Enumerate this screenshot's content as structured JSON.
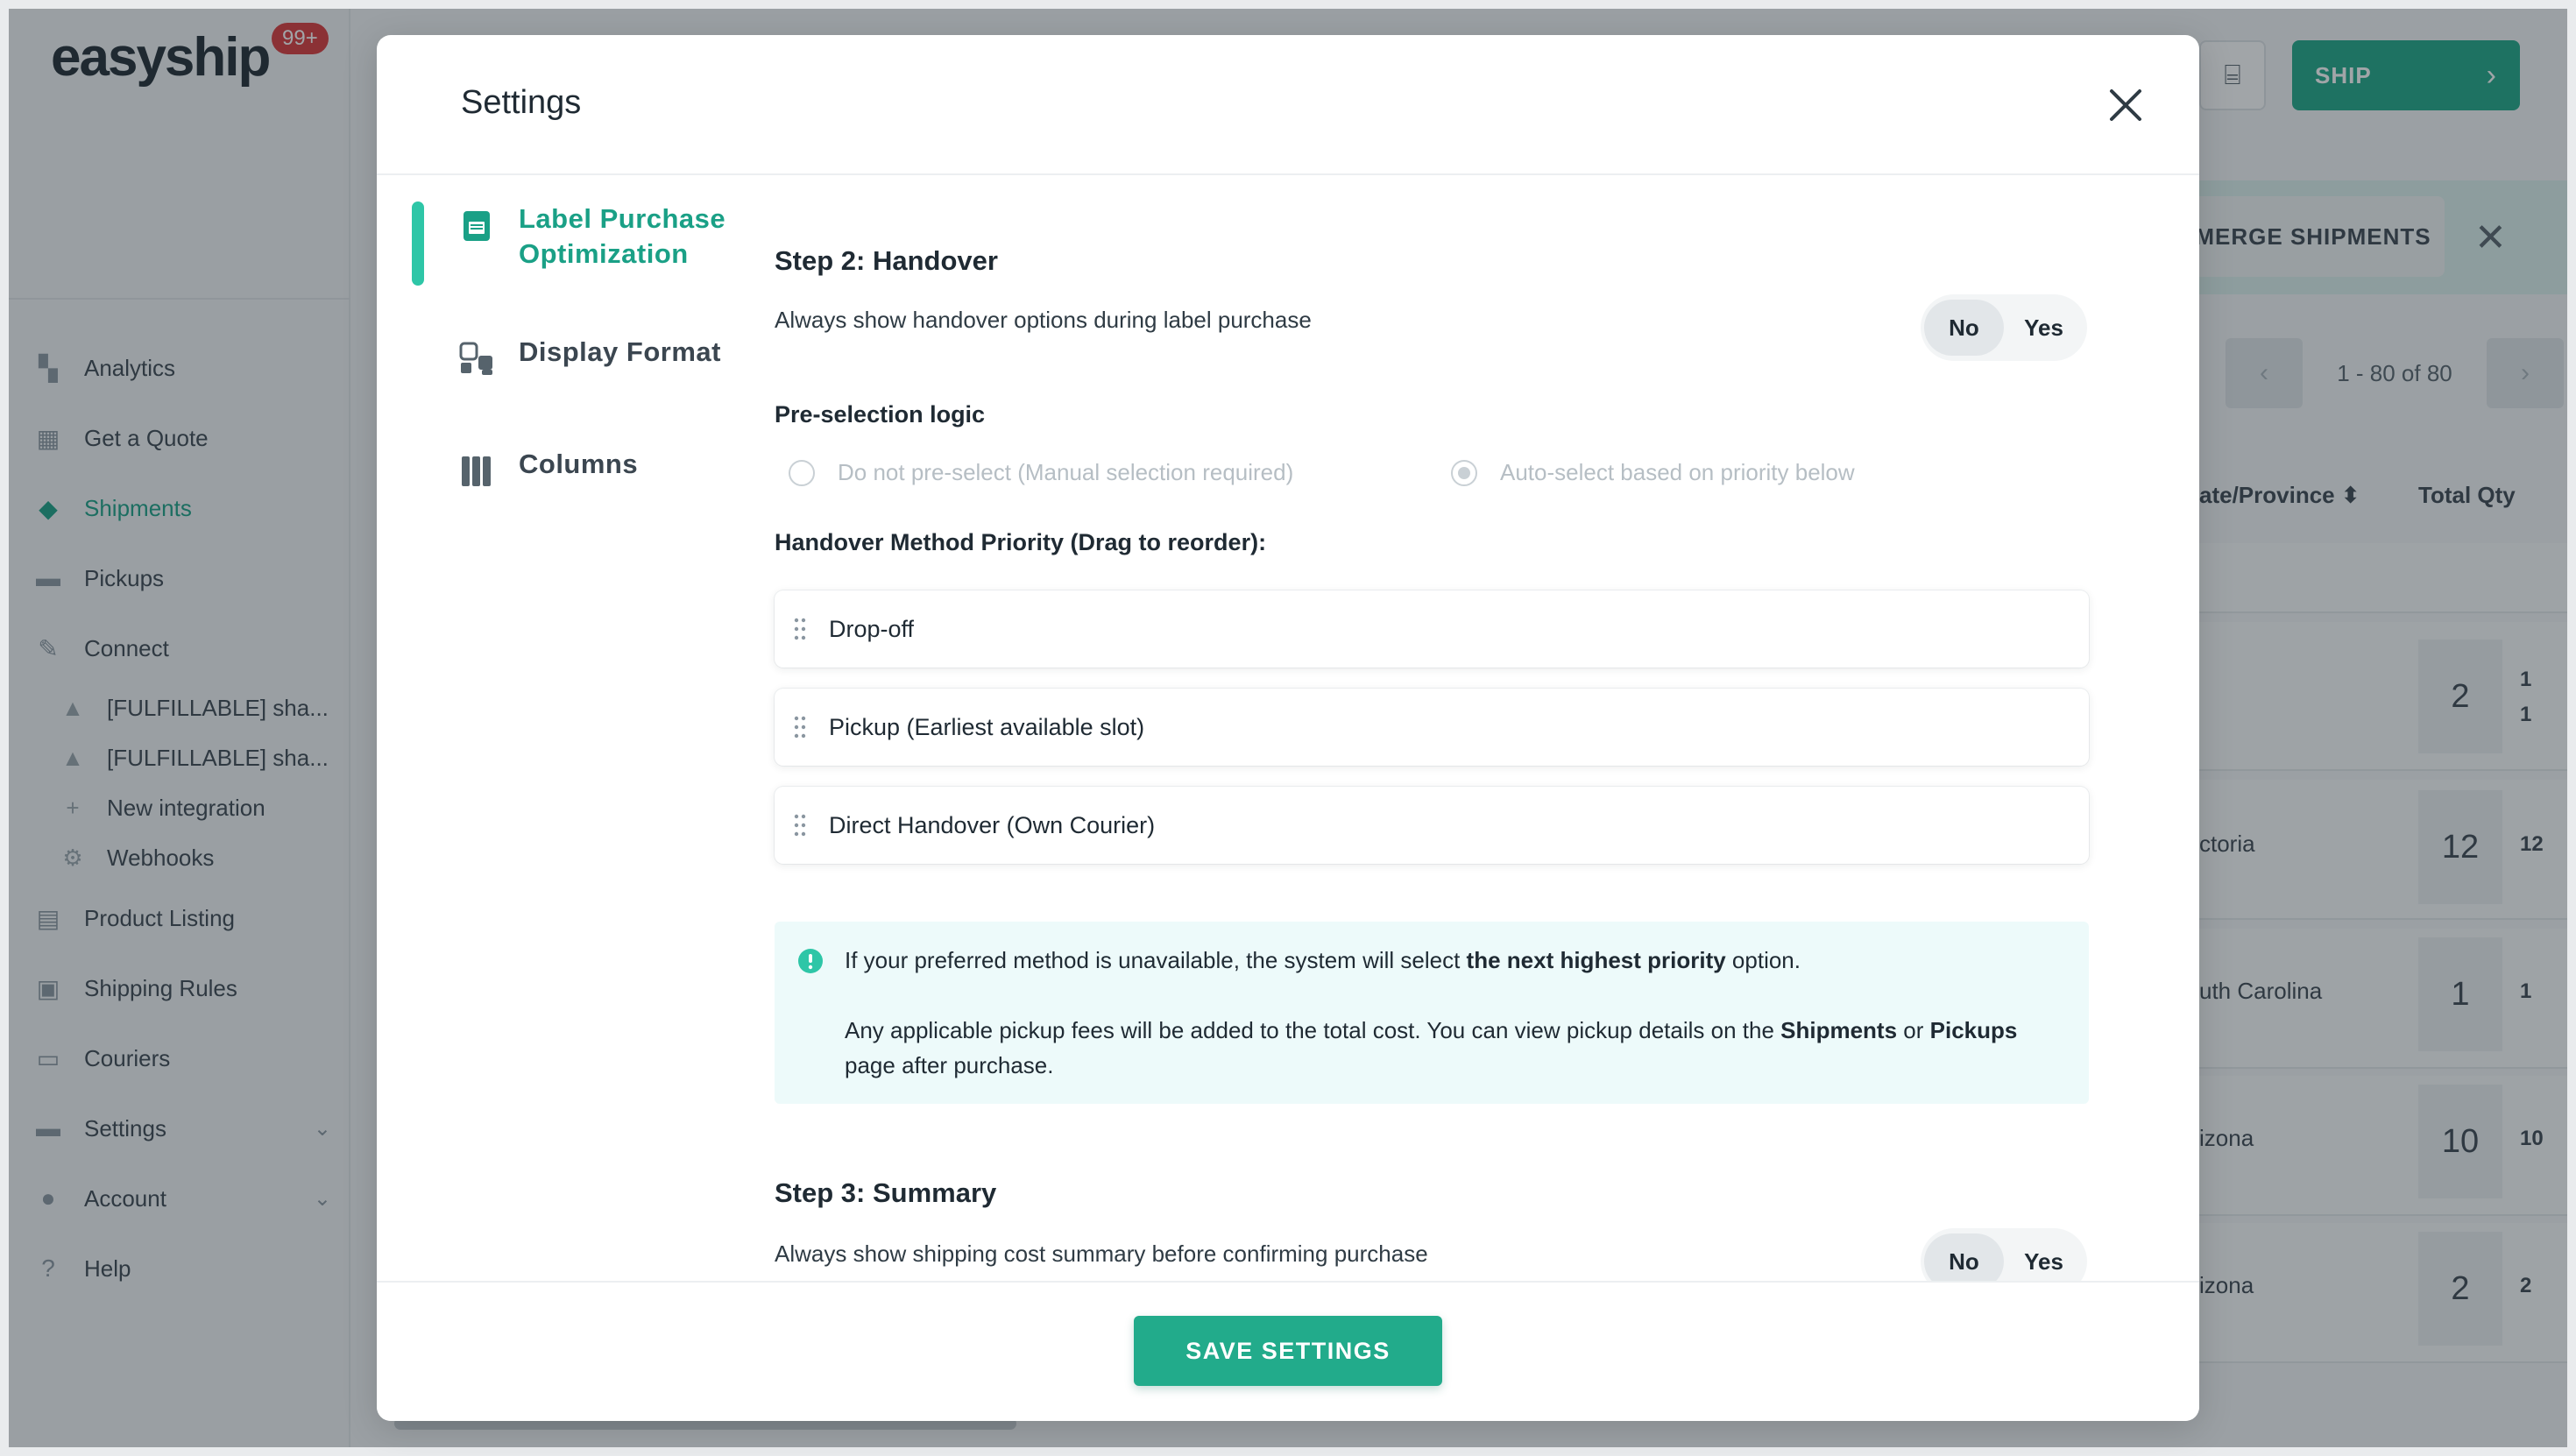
{
  "app": {
    "logo_text": "easyship",
    "notification_count": "99+",
    "ship_button": "SHIP",
    "merge_button": "MERGE SHIPMENTS",
    "pager_text": "1 - 80 of 80",
    "columns": {
      "state": "ate/Province",
      "qty": "Total Qty"
    },
    "rows": [
      {
        "state": "",
        "qty": "2",
        "qty_small_1": "1",
        "qty_small_2": "1"
      },
      {
        "state": "ctoria",
        "qty": "12",
        "qty_small_1": "12"
      },
      {
        "state": "uth Carolina",
        "qty": "1",
        "qty_small_1": "1"
      },
      {
        "state": "izona",
        "qty": "10",
        "qty_small_1": "10"
      },
      {
        "state": "izona",
        "qty": "2",
        "qty_small_1": "2"
      }
    ]
  },
  "sidebar": {
    "items": [
      {
        "label": "Analytics",
        "icon": "analytics-icon"
      },
      {
        "label": "Get a Quote",
        "icon": "quote-icon"
      },
      {
        "label": "Shipments",
        "icon": "box-icon",
        "active": true
      },
      {
        "label": "Pickups",
        "icon": "truck-icon"
      },
      {
        "label": "Connect",
        "icon": "plug-icon"
      }
    ],
    "connect_sub": [
      {
        "label": "[FULFILLABLE] sha...",
        "icon": "store-icon"
      },
      {
        "label": "[FULFILLABLE] sha...",
        "icon": "store-icon"
      },
      {
        "label": "New integration",
        "icon": "plus-icon"
      },
      {
        "label": "Webhooks",
        "icon": "webhook-icon"
      }
    ],
    "items_after": [
      {
        "label": "Product Listing",
        "icon": "product-icon"
      },
      {
        "label": "Shipping Rules",
        "icon": "rules-icon"
      },
      {
        "label": "Couriers",
        "icon": "couriers-icon"
      },
      {
        "label": "Settings",
        "icon": "settings-icon",
        "expandable": true
      },
      {
        "label": "Account",
        "icon": "account-icon",
        "expandable": true
      },
      {
        "label": "Help",
        "icon": "help-icon"
      }
    ]
  },
  "modal": {
    "title": "Settings",
    "nav": [
      {
        "label_line1": "Label Purchase",
        "label_line2": "Optimization",
        "icon": "document-icon",
        "active": true
      },
      {
        "label": "Display Format",
        "icon": "display-format-icon"
      },
      {
        "label": "Columns",
        "icon": "columns-icon"
      }
    ],
    "step2": {
      "title": "Step 2: Handover",
      "description": "Always show handover options during label purchase",
      "toggle": {
        "no": "No",
        "yes": "Yes",
        "selected": "No"
      }
    },
    "preselection": {
      "title": "Pre-selection logic",
      "option_manual": "Do not pre-select (Manual selection required)",
      "option_auto": "Auto-select based on priority below",
      "selected": "auto"
    },
    "priority": {
      "title": "Handover Method Priority (Drag to reorder):",
      "items": [
        "Drop-off",
        "Pickup (Earliest available slot)",
        "Direct Handover (Own Courier)"
      ]
    },
    "info": {
      "line1_pre": "If your preferred method is unavailable, the system will select ",
      "line1_bold": "the next highest priority",
      "line1_post": " option.",
      "line2_pre": "Any applicable pickup fees will be added to the total cost. You can view pickup details on the ",
      "line2_bold1": "Shipments",
      "line2_mid": " or ",
      "line2_bold2": "Pickups",
      "line2_post": " page after purchase."
    },
    "step3": {
      "title": "Step 3: Summary",
      "description": "Always show shipping cost summary before confirming purchase",
      "toggle": {
        "no": "No",
        "yes": "Yes",
        "selected": "No"
      }
    },
    "save_button": "SAVE SETTINGS"
  },
  "colors": {
    "accent": "#1aa086",
    "save": "#22ab8b",
    "info_bg": "#edfafa",
    "info_icon": "#2ec6a7"
  }
}
